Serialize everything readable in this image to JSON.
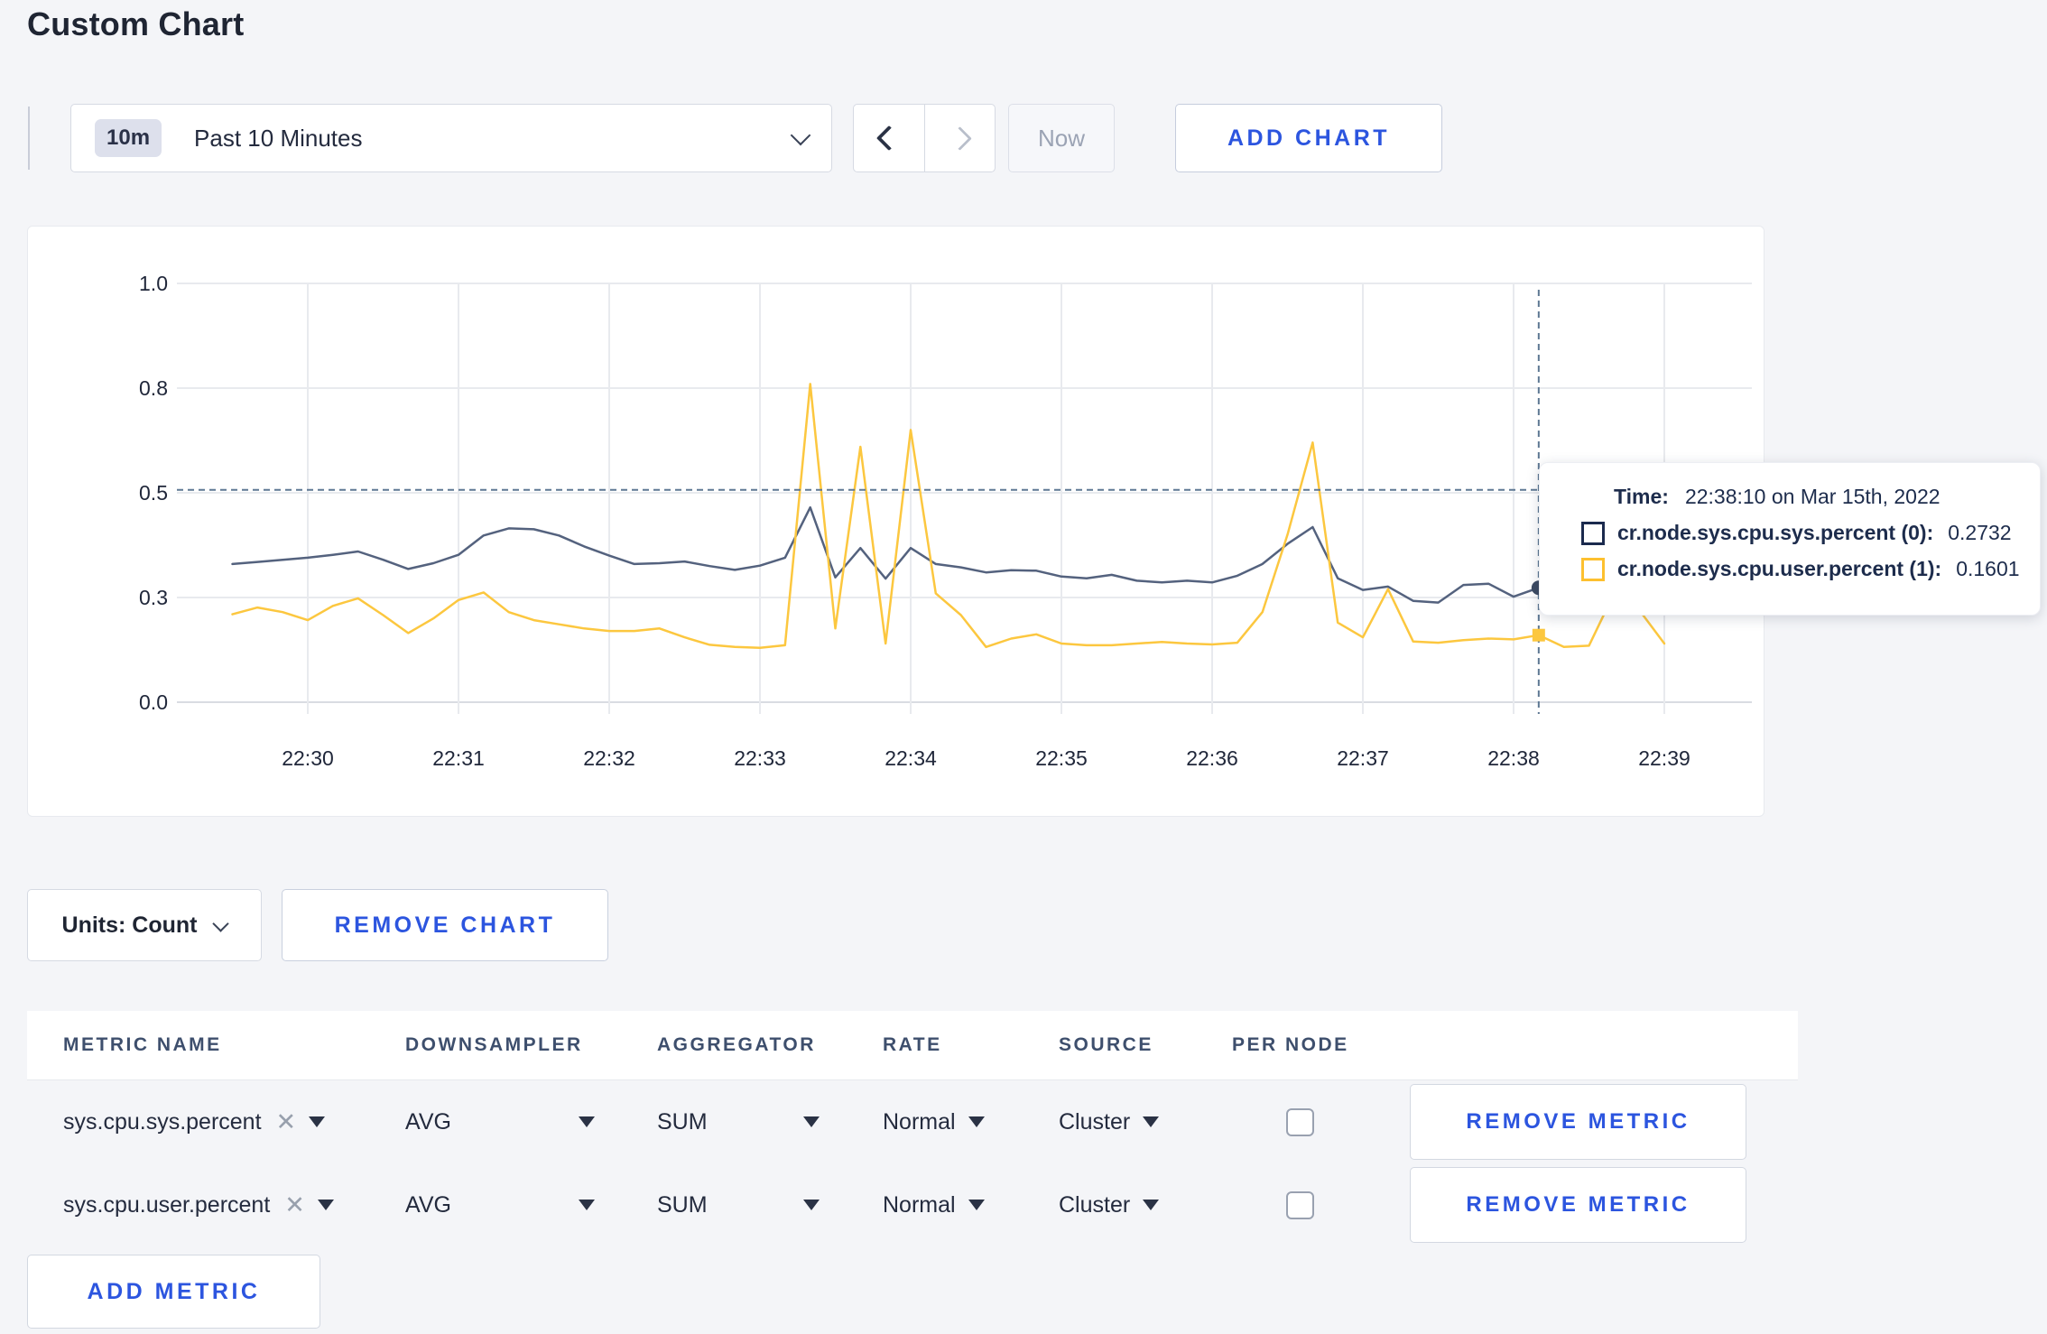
{
  "page": {
    "title": "Custom Chart"
  },
  "toolbar": {
    "time_badge": "10m",
    "time_label": "Past 10 Minutes",
    "now_label": "Now",
    "add_chart_label": "ADD CHART"
  },
  "chart_data": {
    "type": "line",
    "title": "",
    "xlabel": "",
    "ylabel": "",
    "ylim": [
      0,
      1
    ],
    "grid": true,
    "x_ticks": [
      "22:30",
      "22:31",
      "22:32",
      "22:33",
      "22:34",
      "22:35",
      "22:36",
      "22:37",
      "22:38",
      "22:39"
    ],
    "y_ticks": [
      {
        "label": "0.0",
        "value": 0
      },
      {
        "label": "0.3",
        "value": 0.25
      },
      {
        "label": "0.5",
        "value": 0.5
      },
      {
        "label": "0.8",
        "value": 0.75
      },
      {
        "label": "1.0",
        "value": 1
      }
    ],
    "x_start_offset_min": -0.5,
    "x_step_min": 0.16667,
    "series": [
      {
        "name": "cr.node.sys.cpu.sys.percent",
        "color": "#54627e",
        "legend_color": "#1b2a4e",
        "values": [
          0.33,
          0.335,
          0.34,
          0.345,
          0.352,
          0.36,
          0.34,
          0.318,
          0.332,
          0.352,
          0.398,
          0.415,
          0.413,
          0.398,
          0.372,
          0.35,
          0.33,
          0.332,
          0.336,
          0.325,
          0.316,
          0.326,
          0.345,
          0.465,
          0.298,
          0.368,
          0.295,
          0.368,
          0.33,
          0.322,
          0.31,
          0.315,
          0.314,
          0.3,
          0.296,
          0.304,
          0.29,
          0.286,
          0.29,
          0.286,
          0.302,
          0.33,
          0.378,
          0.418,
          0.296,
          0.268,
          0.276,
          0.242,
          0.238,
          0.28,
          0.283,
          0.252,
          0.2732,
          0.26,
          0.27,
          0.28,
          0.275,
          0.282
        ]
      },
      {
        "name": "cr.node.sys.cpu.user.percent",
        "color": "#fcc73f",
        "legend_color": "#fdc02f",
        "values": [
          0.21,
          0.226,
          0.215,
          0.196,
          0.23,
          0.248,
          0.208,
          0.165,
          0.2,
          0.244,
          0.262,
          0.215,
          0.196,
          0.186,
          0.176,
          0.17,
          0.17,
          0.176,
          0.155,
          0.137,
          0.132,
          0.13,
          0.136,
          0.76,
          0.176,
          0.61,
          0.14,
          0.65,
          0.26,
          0.208,
          0.132,
          0.152,
          0.162,
          0.14,
          0.136,
          0.136,
          0.14,
          0.144,
          0.14,
          0.138,
          0.142,
          0.215,
          0.4,
          0.62,
          0.19,
          0.155,
          0.27,
          0.145,
          0.142,
          0.148,
          0.152,
          0.15,
          0.1601,
          0.132,
          0.135,
          0.26,
          0.22,
          0.14
        ]
      }
    ],
    "crosshair": {
      "x_offset_min": 8.1667,
      "hline_value": 0.507,
      "points": [
        {
          "series": 0,
          "value": 0.2732,
          "shape": "circle",
          "color": "#3d4b63"
        },
        {
          "series": 1,
          "value": 0.1601,
          "shape": "square",
          "color": "#fcc73f"
        }
      ]
    }
  },
  "tooltip": {
    "time_label": "Time:",
    "time_value": "22:38:10 on Mar 15th, 2022",
    "entries": [
      {
        "label": "cr.node.sys.cpu.sys.percent (0):",
        "value": "0.2732",
        "color": "#1b2a4e"
      },
      {
        "label": "cr.node.sys.cpu.user.percent (1):",
        "value": "0.1601",
        "color": "#fdc02f"
      }
    ]
  },
  "chart_footer": {
    "units_label": "Units: Count",
    "remove_chart_label": "REMOVE CHART"
  },
  "metrics_table": {
    "headers": [
      "METRIC NAME",
      "DOWNSAMPLER",
      "AGGREGATOR",
      "RATE",
      "SOURCE",
      "PER NODE"
    ],
    "rows": [
      {
        "metric": "sys.cpu.sys.percent",
        "downsampler": "AVG",
        "aggregator": "SUM",
        "rate": "Normal",
        "source": "Cluster",
        "per_node_checked": false,
        "remove_label": "REMOVE METRIC"
      },
      {
        "metric": "sys.cpu.user.percent",
        "downsampler": "AVG",
        "aggregator": "SUM",
        "rate": "Normal",
        "source": "Cluster",
        "per_node_checked": false,
        "remove_label": "REMOVE METRIC"
      }
    ],
    "add_metric_label": "ADD METRIC"
  },
  "colors": {
    "accent_blue": "#2c55df",
    "page_bg": "#f4f5f8",
    "grid_line": "#e8eaee",
    "zero_line": "#d9dce2",
    "crosshair": "#5e7893"
  }
}
